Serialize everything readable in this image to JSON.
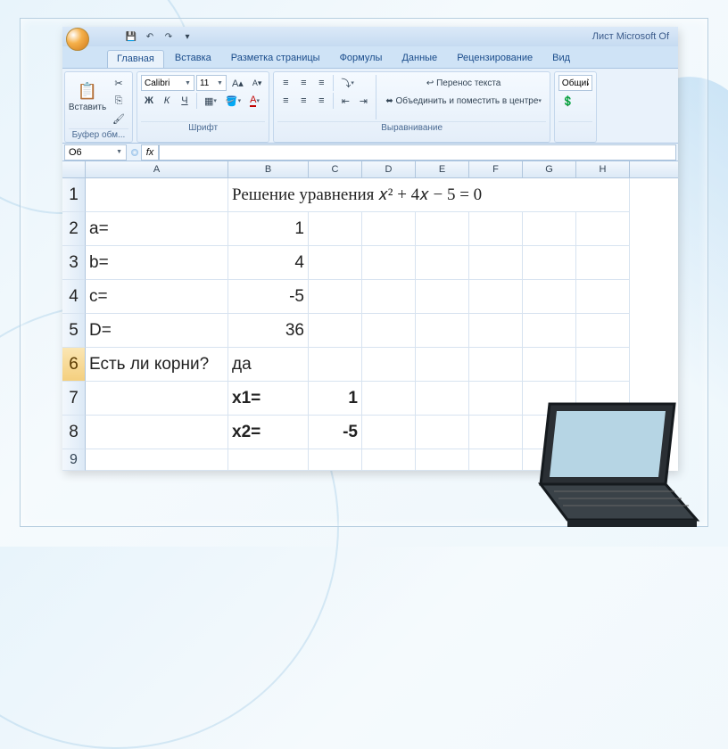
{
  "window": {
    "title": "Лист Microsoft Of"
  },
  "tabs": {
    "home": "Главная",
    "insert": "Вставка",
    "layout": "Разметка страницы",
    "formulas": "Формулы",
    "data": "Данные",
    "review": "Рецензирование",
    "view": "Вид"
  },
  "ribbon": {
    "clipboard": {
      "paste": "Вставить",
      "label": "Буфер обм..."
    },
    "font": {
      "name": "Calibri",
      "size": "11",
      "label": "Шрифт",
      "bold": "Ж",
      "italic": "К",
      "underline": "Ч"
    },
    "align": {
      "wrap": "Перенос текста",
      "merge": "Объединить и поместить в центре",
      "label": "Выравнивание"
    },
    "number": {
      "general": "Общий"
    }
  },
  "namebox": "O6",
  "columns": [
    "A",
    "B",
    "C",
    "D",
    "E",
    "F",
    "G",
    "H"
  ],
  "rows": [
    {
      "n": "1",
      "h": "tall",
      "cells": {
        "B": "Решение уравнения 𝑥² + 4𝑥 − 5 = 0",
        "span": true
      }
    },
    {
      "n": "2",
      "h": "tall",
      "cells": {
        "A": "a=",
        "B": "1"
      }
    },
    {
      "n": "3",
      "h": "tall",
      "cells": {
        "A": "b=",
        "B": "4"
      }
    },
    {
      "n": "4",
      "h": "tall",
      "cells": {
        "A": "c=",
        "B": "-5"
      }
    },
    {
      "n": "5",
      "h": "tall",
      "cells": {
        "A": "D=",
        "B": "36"
      }
    },
    {
      "n": "6",
      "h": "tall",
      "cells": {
        "A": "Есть ли корни?",
        "B_left": "да"
      },
      "active": true
    },
    {
      "n": "7",
      "h": "tall",
      "cells": {
        "B_bold": "x1=",
        "C_bold": "1"
      }
    },
    {
      "n": "8",
      "h": "tall",
      "cells": {
        "B_bold": "x2=",
        "C_bold": "-5"
      }
    },
    {
      "n": "9",
      "h": "short",
      "cells": {}
    }
  ]
}
